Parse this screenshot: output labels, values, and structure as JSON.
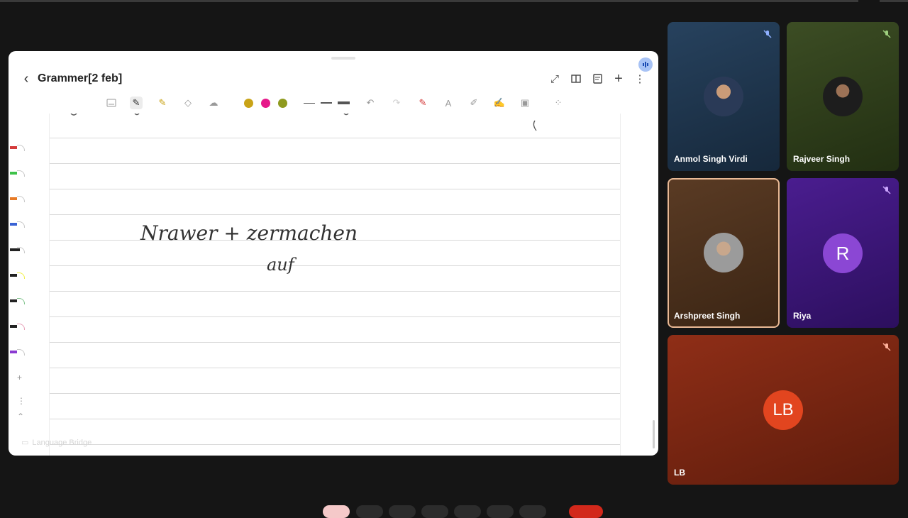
{
  "notebook": {
    "title": "Grammer[2 feb]",
    "handwriting": [
      "Nrawer + zermachen",
      "auf"
    ],
    "watermark": "Language Bridge",
    "colors": {
      "swatch1": "#c9a317",
      "swatch2": "#e6198a",
      "swatch3": "#8f9a1f"
    }
  },
  "participants": [
    {
      "name": "Anmol Singh Virdi",
      "muted": true,
      "bg": "#1d3146"
    },
    {
      "name": "Rajveer Singh",
      "muted": true,
      "bg": "#2b3a18"
    },
    {
      "name": "Arshpreet Singh",
      "muted": false,
      "active_speaker": true,
      "bg": "#4a3220"
    },
    {
      "name": "Riya",
      "muted": true,
      "initial": "R",
      "bg": "#3b167a",
      "avatar_color": "#8b47d4"
    },
    {
      "name": "LB",
      "muted": true,
      "initial": "LB",
      "bg": "#7c2412",
      "avatar_color": "#e2451f"
    }
  ]
}
